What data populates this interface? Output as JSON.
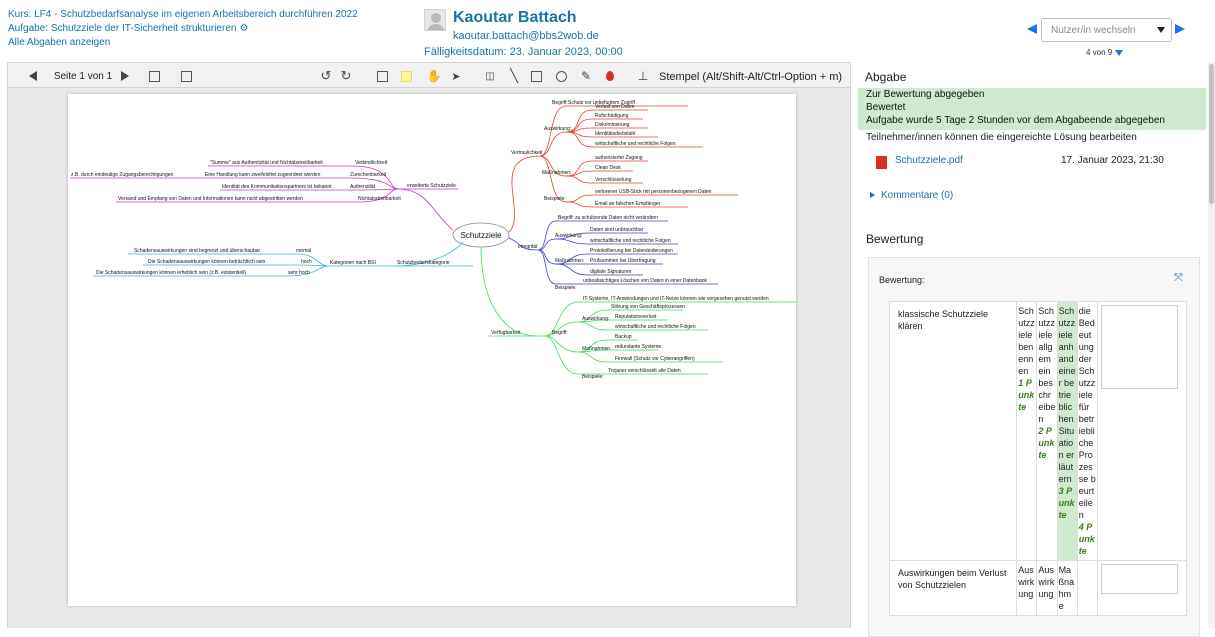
{
  "header": {
    "course_link": "Kurs: LF4 - Schutzbedarfsanalyse im eigenen Arbeitsbereich durchführen 2022",
    "assignment_link": "Aufgabe: Schutzziele der IT-Sicherheit strukturieren",
    "all_submissions_link": "Alle Abgaben anzeigen",
    "user_name": "Kaoutar Battach",
    "user_email": "kaoutar.battach@bbs2wob.de",
    "due_date": "Fälligkeitsdatum: 23. Januar 2023, 00:00",
    "change_user_placeholder": "Nutzer/in wechseln",
    "user_count": "4 von 9"
  },
  "toolbar": {
    "page_label": "Seite 1 von 1",
    "stamp_label": "Stempel (Alt/Shift-Alt/Ctrl-Option + m)"
  },
  "mindmap": {
    "center": "Schutzziele",
    "vertraulichkeit": {
      "label": "Vertraulichkeit",
      "begriff_label": "Begriff:",
      "begriff": "Schutz vor unbefugtem Zugriff",
      "auswirkung_label": "Auswirkung:",
      "auswirkung": [
        "Verlust von Daten",
        "Rufschädigung",
        "Diskriminierung",
        "Identitätsdiebstahl",
        "wirtschaftliche und rechtliche Folgen"
      ],
      "massnahmen_label": "Maßnahmen:",
      "massnahmen": [
        "authorisierter Zugang",
        "Clean Desk",
        "Verschlüsselung"
      ],
      "beispiele_label": "Beispiele:",
      "beispiele": [
        "verlorener USB-Stick mit personenbezogenen Daten",
        "Email an falschen Empfänger"
      ]
    },
    "integritaet": {
      "label": "Integrität",
      "begriff": "Begriff: zu schützende Daten nicht verändern",
      "auswirkung_label": "Auswirkung:",
      "auswirkung": [
        "Daten sind unbrauchbar",
        "wirtschaftliche und rechtliche Folgen"
      ],
      "massnahmen_label": "Maßnahmen:",
      "massnahmen": [
        "Protokollierung bei Datenänderungen",
        "Prüfsummen bei Übertragung",
        "digitale Signaturen"
      ],
      "beispiele_label": "Beispiele:",
      "beispiel": "unbeabsichtiges Löschen von Daten in einer Datenbank"
    },
    "verfuegbarkeit": {
      "label": "Verfügbarkeit",
      "begriff_label": "Begriff:",
      "begriff": "IT-Systeme, IT-Anwendungen und IT-Netze können wie vorgesehen genutzt werden",
      "auswirkung_label": "Auswirkung:",
      "auswirkung": [
        "Störung von Geschäftsprozessen",
        "Reputationsverlust",
        "wirtschaftliche und rechtliche Folgen"
      ],
      "massnahmen_label": "Maßnahmen",
      "massnahmen": [
        "Backup",
        "redundante Systeme",
        "Firewall (Schutz vor Cyberangriffen)"
      ],
      "beispiele_label": "Beispiele:",
      "beispiel": "Trojaner verschlüsselt alle Daten"
    },
    "erweiterte": {
      "label": "erweiterte Schutzziele",
      "items": [
        "Verbindlichkeit",
        "Zurechenbarkeit",
        "Authenzität",
        "Nichtabstreitbarkeit"
      ],
      "descs": [
        "\"Summe\" aus Authentizität und Nichtabstreitbarkeit",
        "Eine Handlung kann zweifelsfrei zugeordnet werden",
        "Identität des Kommunikationspartners ist bekannt",
        "Versand und Empfang von Daten und Informationen kann nicht abgestritten werden"
      ],
      "extra": "z.B. durch eindeutige Zugangsberechtigungen"
    },
    "schutzbedarf": {
      "label": "Schutzbedarfskategorie",
      "sub": "Kategorien nach BSI",
      "levels": [
        "normal",
        "hoch",
        "sehr hoch"
      ],
      "descs": [
        "Schadensauswirkungen sind begrenzt und überschaubar",
        "Die Schadensauswirkungen können beträchtlich sein",
        "Die Schadensauswirkungen können erheblich sein (z.B. existentiell)"
      ]
    }
  },
  "panel": {
    "title": "Abgabe",
    "status1": "Zur Bewertung abgegeben",
    "status2": "Bewertet",
    "status3": "Aufgabe wurde 5 Tage 2 Stunden vor dem Abgabeende abgegeben",
    "editable": "Teilnehmer/innen können die eingereichte Lösung bearbeiten",
    "file_name": "Schutzziele.pdf",
    "file_date": "17. Januar 2023, 21:30",
    "comments": "Kommentare (0)",
    "grading_title": "Bewertung",
    "grading_label": "Bewertung:"
  },
  "rubric": [
    {
      "criterion": "klassische Schutzziele klären",
      "levels": [
        {
          "text": "Schutzziele benennen",
          "points": "1 Punkte",
          "selected": false
        },
        {
          "text": "Schutzziele allgemein beschreiben",
          "points": "2 Punkte",
          "selected": false
        },
        {
          "text": "Schutzziele anhand einer betrieblichen Situation erläutern",
          "points": "3 Punkte",
          "selected": true
        },
        {
          "text": "die Bedeutung der Schutzziele für betriebliche Prozesse beurteilen",
          "points": "4 Punkte",
          "selected": false
        }
      ]
    },
    {
      "criterion": "Auswirkungen beim Verlust von Schutzzielen",
      "levels": [
        {
          "text": "Auswirkung",
          "points": "",
          "selected": false
        },
        {
          "text": "Auswirkung",
          "points": "",
          "selected": false
        },
        {
          "text": "Maßnahme",
          "points": "",
          "selected": false
        }
      ]
    }
  ],
  "colors": {
    "link": "#1a73a8",
    "accent_blue": "#1a73e8",
    "status_green": "#cfeacf",
    "points_green": "#3b7a1a",
    "vertraulichkeit": "#e0442e",
    "integritaet": "#3b3fc9",
    "verfuegbarkeit": "#3ddc5a",
    "erweiterte": "#cc33cc",
    "schutzbedarf": "#33b5d6"
  }
}
